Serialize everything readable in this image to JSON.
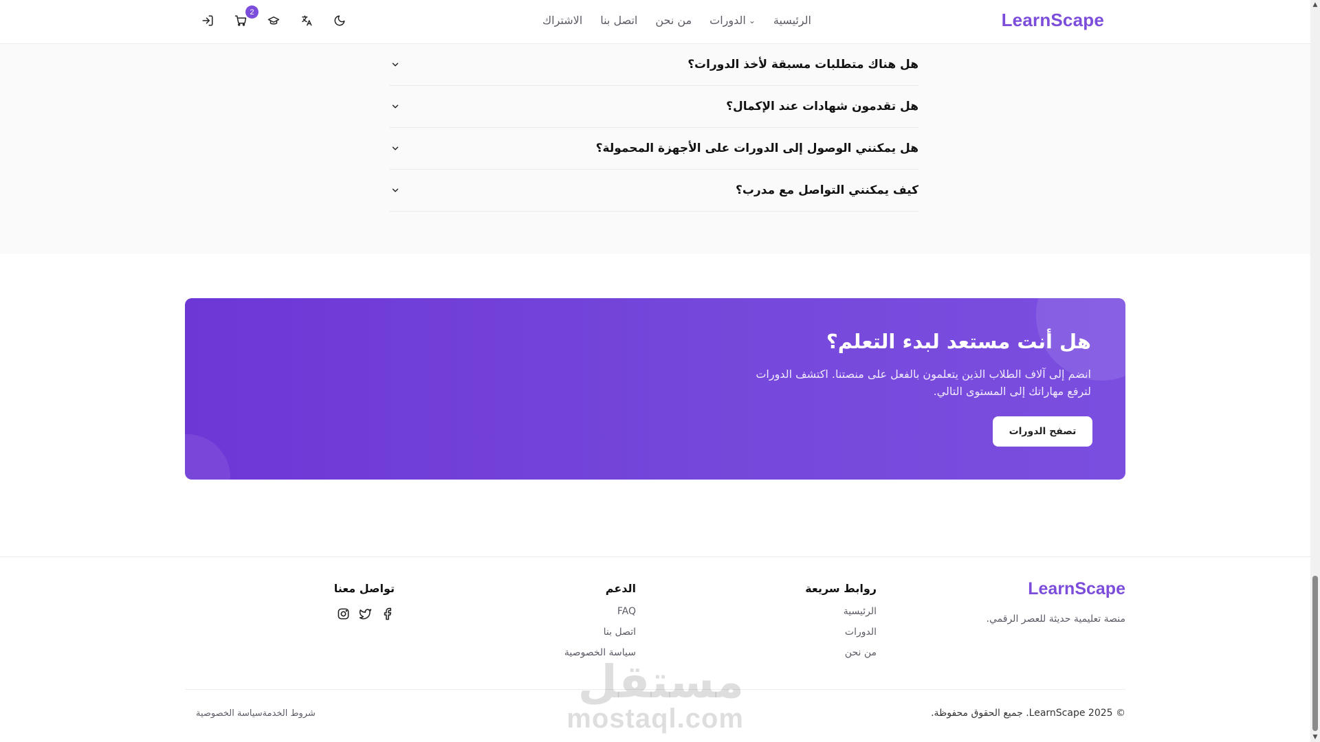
{
  "header": {
    "logo": "LearnScape",
    "nav": [
      {
        "label": "الرئيسية",
        "dropdown": false
      },
      {
        "label": "الدورات",
        "dropdown": true
      },
      {
        "label": "من نحن",
        "dropdown": false
      },
      {
        "label": "اتصل بنا",
        "dropdown": false
      },
      {
        "label": "الاشتراك",
        "dropdown": false
      }
    ],
    "cart_count": "2",
    "icons": [
      "login-icon",
      "cart-icon",
      "graduation-cap-icon",
      "translate-icon",
      "moon-icon"
    ]
  },
  "faq": {
    "items": [
      "هل هناك متطلبات مسبقة لأخذ الدورات؟",
      "هل تقدمون شهادات عند الإكمال؟",
      "هل يمكنني الوصول إلى الدورات على الأجهزة المحمولة؟",
      "كيف يمكنني التواصل مع مدرب؟"
    ]
  },
  "cta": {
    "title": "هل أنت مستعد لبدء التعلم؟",
    "text": "انضم إلى آلاف الطلاب الذين يتعلمون بالفعل على منصتنا. اكتشف الدورات لترفع مهاراتك إلى المستوى التالي.",
    "button": "تصفح الدورات"
  },
  "footer": {
    "logo": "LearnScape",
    "tagline": "منصة تعليمية حديثة للعصر الرقمي.",
    "quick_links": {
      "title": "روابط سريعة",
      "links": [
        "الرئيسية",
        "الدورات",
        "من نحن"
      ]
    },
    "support": {
      "title": "الدعم",
      "links": [
        "FAQ",
        "اتصل بنا",
        "سياسة الخصوصية"
      ]
    },
    "contact": {
      "title": "تواصل معنا",
      "icons": [
        "facebook-icon",
        "twitter-icon",
        "instagram-icon"
      ]
    },
    "copyright": "© 2025 LearnScape. جميع الحقوق محفوظة.",
    "legal": [
      "شروط الخدمة",
      "سياسة الخصوصية"
    ]
  },
  "watermark": {
    "ar": "مستقل",
    "en": "mostaql.com"
  }
}
